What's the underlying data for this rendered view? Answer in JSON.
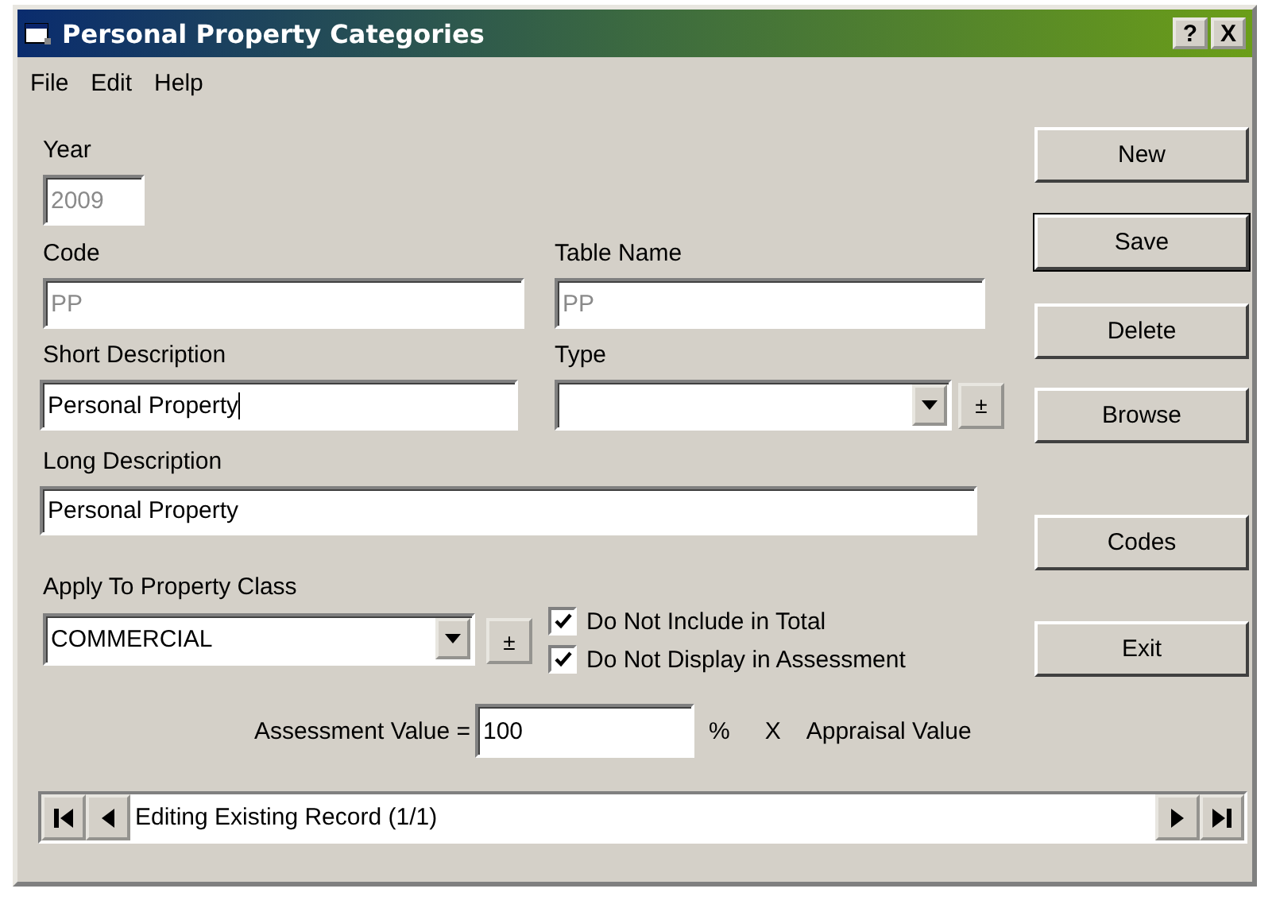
{
  "window": {
    "title": "Personal Property Categories",
    "caption_buttons": [
      "?",
      "X"
    ]
  },
  "menu": [
    {
      "label": "File"
    },
    {
      "label": "Edit"
    },
    {
      "label": "Help"
    }
  ],
  "fields": {
    "year": {
      "label": "Year",
      "value": "2009",
      "disabled": true
    },
    "code": {
      "label": "Code",
      "value": "PP",
      "disabled": true
    },
    "table_name": {
      "label": "Table Name",
      "value": "PP",
      "disabled": true
    },
    "short_description": {
      "label": "Short Description",
      "value": "Personal Property",
      "disabled": false,
      "focused": true
    },
    "type": {
      "label": "Type",
      "add_button": "±"
    },
    "long_description": {
      "label": "Long Description",
      "value": "Personal Property",
      "disabled": false
    },
    "property_class": {
      "label": "Apply To Property Class",
      "value": "COMMERCIAL",
      "add_button": "±"
    }
  },
  "checkboxes": [
    {
      "label": "Do Not Include in Total",
      "checked": true
    },
    {
      "label": "Do Not Display in Assessment",
      "checked": true
    }
  ],
  "assessment": {
    "label": "Assessment Value =",
    "value": "100",
    "percent": "%",
    "times": "X",
    "base": "Appraisal Value"
  },
  "navigator": {
    "status": "Editing Existing Record (1/1)"
  },
  "buttons": [
    {
      "label": "New",
      "default": false
    },
    {
      "label": "Save",
      "default": true
    },
    {
      "label": "Delete",
      "default": false
    },
    {
      "label": "Browse",
      "default": false
    },
    {
      "label": "Codes",
      "default": false
    },
    {
      "label": "Exit",
      "default": false
    }
  ]
}
